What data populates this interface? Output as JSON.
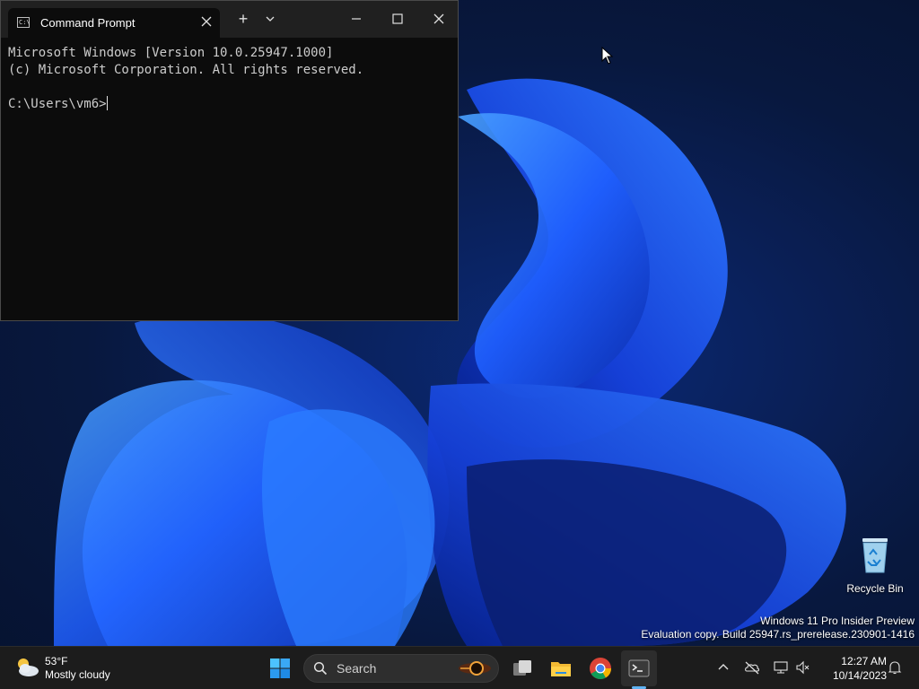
{
  "window": {
    "tab_title": "Command Prompt",
    "new_tab_symbol": "+",
    "terminal_lines": [
      "Microsoft Windows [Version 10.0.25947.1000]",
      "(c) Microsoft Corporation. All rights reserved.",
      "",
      "C:\\Users\\vm6>"
    ]
  },
  "desktop": {
    "recycle_bin_label": "Recycle Bin",
    "watermark_line1": "Windows 11 Pro Insider Preview",
    "watermark_line2": "Evaluation copy. Build 25947.rs_prerelease.230901-1416"
  },
  "taskbar": {
    "weather_temp": "53°F",
    "weather_desc": "Mostly cloudy",
    "search_placeholder": "Search",
    "clock_time": "12:27 AM",
    "clock_date": "10/14/2023"
  },
  "colors": {
    "accent": "#0078d4",
    "terminal_bg": "#0c0c0c",
    "taskbar_bg": "#1c1c1c"
  }
}
